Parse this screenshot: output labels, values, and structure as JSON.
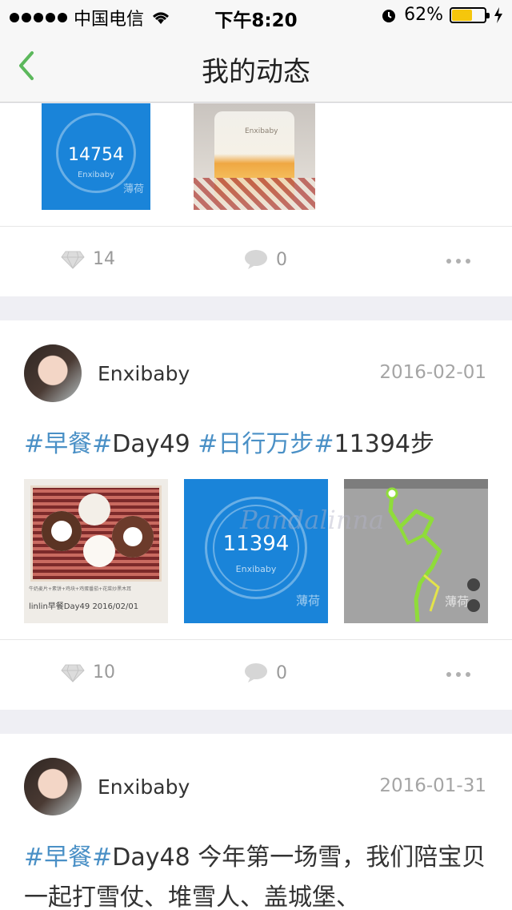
{
  "status": {
    "carrier": "中国电信",
    "time": "下午8:20",
    "battery": "62%",
    "battery_level": 0.62
  },
  "nav": {
    "title": "我的动态"
  },
  "posts": [
    {
      "images": [
        {
          "steps": "14754",
          "sub": "Enxibaby",
          "corner": "薄荷"
        },
        {
          "note": "Enxibaby"
        }
      ],
      "likes": "14",
      "comments": "0"
    },
    {
      "user": "Enxibaby",
      "date": "2016-02-01",
      "text": {
        "tag1": "#早餐#",
        "plain1": "Day49 ",
        "tag2": "#日行万步#",
        "plain2": "11394步"
      },
      "images": [
        {
          "caption": "linlin早餐Day49 2016/02/01",
          "menu": "牛奶麦片+素饼+鸡块+鸡蛋番茄+花菜炒黑木耳"
        },
        {
          "steps": "11394",
          "sub": "Enxibaby",
          "corner": "薄荷"
        },
        {
          "map_label": "薄荷",
          "watermark": "Pandalinna"
        }
      ],
      "likes": "10",
      "comments": "0"
    },
    {
      "user": "Enxibaby",
      "date": "2016-01-31",
      "text": {
        "tag1": "#早餐#",
        "plain1": "Day48  今年第一场雪，我们陪宝贝一起打雪仗、堆雪人、盖城堡、"
      }
    }
  ],
  "icons": {
    "like": "diamond-icon",
    "comment": "speech-bubble-icon",
    "more": "more-dots-icon",
    "back": "chevron-left-icon"
  },
  "colors": {
    "accent": "#5cb85c",
    "tag": "#4a90c6",
    "step_blue": "#1a84d9"
  }
}
